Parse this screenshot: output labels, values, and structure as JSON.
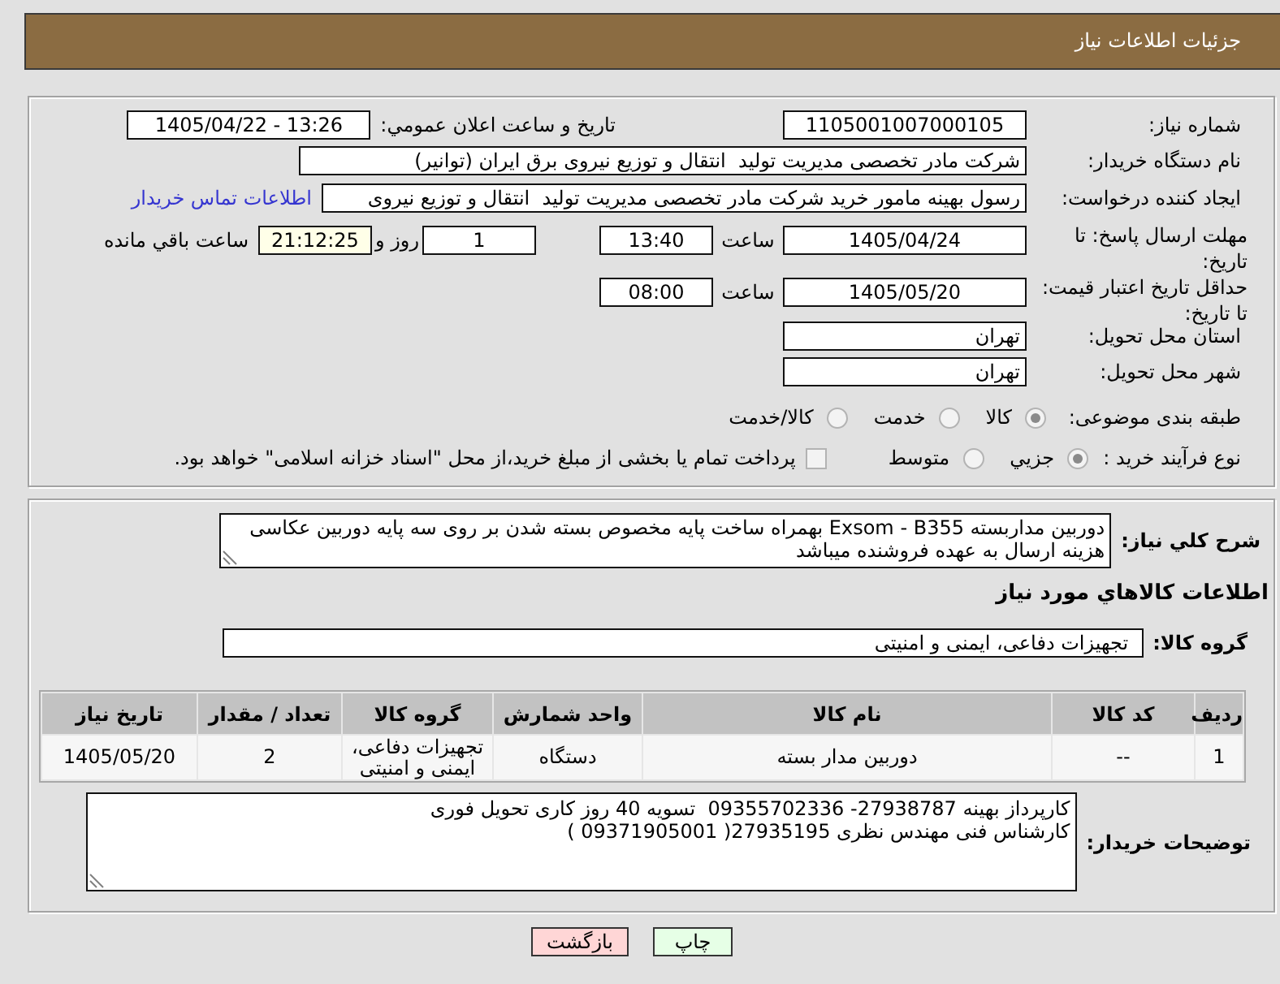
{
  "header": {
    "title": "جزئیات اطلاعات نیاز"
  },
  "details": {
    "need_number": {
      "label": "شماره نیاز:",
      "value": "1105001007000105"
    },
    "announced": {
      "label": "تاريخ و ساعت اعلان عمومي:",
      "value": "1405/04/22 - 13:26"
    },
    "buyer": {
      "label": "نام دستگاه خریدار:",
      "value": "شرکت مادر تخصصی مدیریت تولید  انتقال و توزیع نیروی برق ایران (توانیر)"
    },
    "requester": {
      "label": "ایجاد کننده درخواست:",
      "value": "رسول بهینه مامور خرید شرکت مادر تخصصی مدیریت تولید  انتقال و توزیع نیروی",
      "contact_link": "اطلاعات تماس خریدار"
    },
    "reply_deadline": {
      "label": "مهلت ارسال پاسخ: تا تاریخ:",
      "date": "1405/04/24",
      "time_label": "ساعت",
      "time": "13:40",
      "days": "1",
      "days_label": "روز و",
      "remaining": "21:12:25",
      "remaining_label": "ساعت باقي مانده"
    },
    "price_validity": {
      "label": "حداقل تاریخ اعتبار قیمت: تا تاریخ:",
      "date": "1405/05/20",
      "time_label": "ساعت",
      "time": "08:00"
    },
    "delivery_province": {
      "label": "استان محل تحویل:",
      "value": "تهران"
    },
    "delivery_city": {
      "label": "شهر محل تحویل:",
      "value": "تهران"
    },
    "subject_category": {
      "label": "طبقه بندی موضوعی:",
      "options": [
        {
          "label": "کالا",
          "selected": true
        },
        {
          "label": "خدمت",
          "selected": false
        },
        {
          "label": "کالا/خدمت",
          "selected": false
        }
      ]
    },
    "purchase_process": {
      "label": "نوع فرآیند خرید :",
      "options": [
        {
          "label": "جزيي",
          "selected": true
        },
        {
          "label": "متوسط",
          "selected": false
        }
      ],
      "treasury_payment": {
        "label": "پرداخت تمام یا بخشی از مبلغ خرید،از محل \"اسناد خزانه اسلامی\" خواهد بود.",
        "checked": false
      }
    }
  },
  "requirements": {
    "description": {
      "label": "شرح کلي نياز:",
      "value": "دوربین مداربسته Exsom - B355 بهمراه ساخت پایه مخصوص بسته شدن بر روی سه پایه دوربین عکاسی\nهزینه ارسال به عهده فروشنده میباشد"
    },
    "goods_title": "اطلاعات کالاهاي مورد نياز",
    "goods_group": {
      "label": "گروه کالا:",
      "value": "تجهیزات دفاعی، ایمنی و امنیتی"
    },
    "table": {
      "columns": [
        "ردیف",
        "کد کالا",
        "نام کالا",
        "واحد شمارش",
        "گروه کالا",
        "تعداد / مقدار",
        "تاریخ نیاز"
      ],
      "rows": [
        [
          "1",
          "--",
          "دوربین مدار بسته",
          "دستگاه",
          "تجهیزات دفاعی، ایمنی و امنیتی",
          "2",
          "1405/05/20"
        ]
      ]
    },
    "buyer_notes": {
      "label": "توضیحات خریدار:",
      "value": "کارپرداز بهینه 27938787- 09355702336  تسویه 40 روز کاری تحویل فوری\nکارشناس فنی مهندس نظری 27935195( 09371905001 )"
    }
  },
  "buttons": [
    {
      "label": "چاپ",
      "kind": "print"
    },
    {
      "label": "بازگشت",
      "kind": "back"
    }
  ]
}
